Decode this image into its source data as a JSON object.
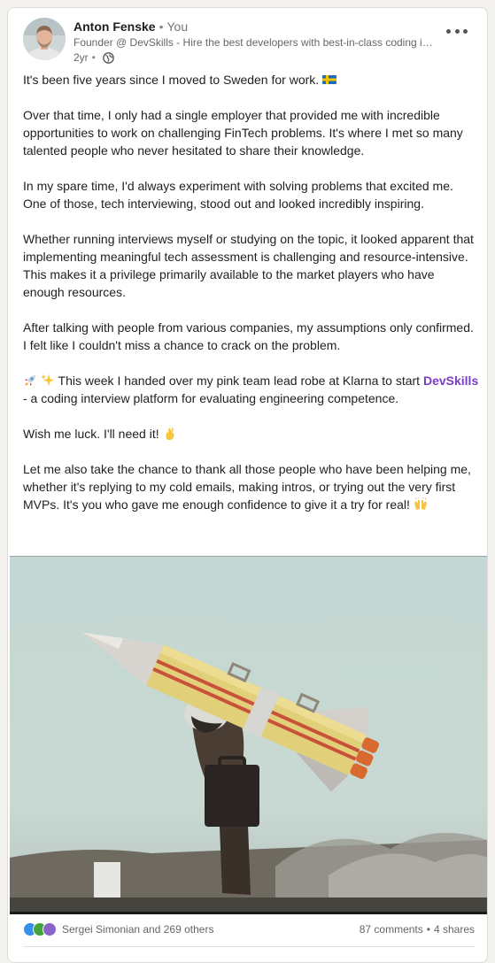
{
  "post": {
    "author": {
      "name": "Anton Fenske",
      "relation": "You",
      "headline": "Founder @ DevSkills - Hire the best developers with best-in-class coding interviews",
      "time": "2yr",
      "visibility_icon": "globe-icon"
    },
    "menu_icon": "more-horizontal-icon",
    "body": {
      "p1_text": "It's been five years since I moved to Sweden for work.",
      "p1_emoji": "sweden-flag-emoji",
      "p2": "Over that time, I only had a single employer that provided me with incredible opportunities to work on challenging FinTech problems. It's where I met so many talented people who never hesitated to share their knowledge.",
      "p3": "In my spare time, I'd always experiment with solving problems that excited me. One of those, tech interviewing, stood out and looked incredibly inspiring.",
      "p4": "Whether running interviews myself or studying on the topic, it looked apparent that implementing meaningful tech assessment is challenging and resource-intensive. This makes it a privilege primarily available to the market players who have enough resources.",
      "p5": "After talking with people from various companies, my assumptions only confirmed. I felt like I couldn't miss a chance to crack on the problem.",
      "p6_emojis": [
        "rocket-emoji",
        "sparkles-emoji"
      ],
      "p6_before": "This week I handed over my pink team lead robe at Klarna to start",
      "p6_link": "DevSkills",
      "p6_after": "- a coding interview platform for evaluating engineering competence.",
      "p7_text": "Wish me luck. I'll need it!",
      "p7_emoji": "crossed-fingers-emoji",
      "p8_text": "Let me also take the chance to thank all those people who have been helping me, whether it's replying to my cold emails, making intros, or trying out the very first MVPs. It's you who gave me enough confidence to give it a try for real!",
      "p8_emoji": "raised-hands-emoji"
    },
    "image": {
      "subject": "man-carrying-rocket-image"
    },
    "social": {
      "reaction_icons": [
        "like-reaction-icon",
        "celebrate-reaction-icon",
        "love-reaction-icon"
      ],
      "reactions_text": "Sergei Simonian and 269 others",
      "comments": "87 comments",
      "separator": "•",
      "shares": "4 shares"
    }
  },
  "colors": {
    "hashtag": "#7a3ec6",
    "like": "#378fe9",
    "celebrate": "#44a33d",
    "love": "#8a63c7"
  }
}
